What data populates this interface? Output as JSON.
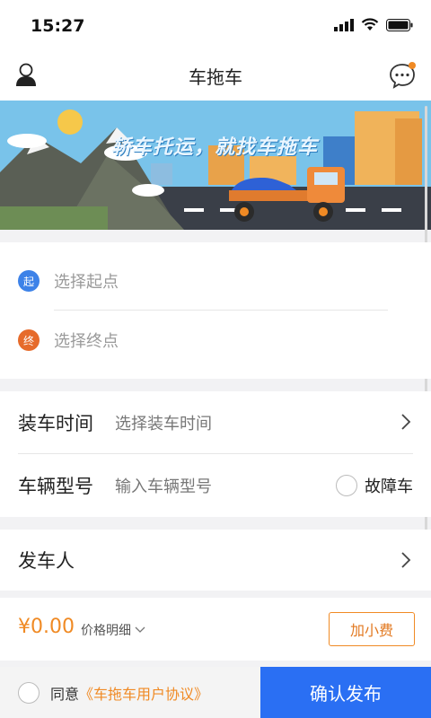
{
  "status": {
    "time": "15:27"
  },
  "nav": {
    "title": "车拖车",
    "has_notification": true
  },
  "banner": {
    "slogan": "轿车托运，就找车拖车"
  },
  "route": {
    "start_badge": "起",
    "start_placeholder": "选择起点",
    "end_badge": "终",
    "end_placeholder": "选择终点"
  },
  "form": {
    "load_time_label": "装车时间",
    "load_time_placeholder": "选择装车时间",
    "model_label": "车辆型号",
    "model_placeholder": "输入车辆型号",
    "fault_label": "故障车"
  },
  "sender": {
    "label": "发车人"
  },
  "price": {
    "amount": "¥0.00",
    "detail_label": "价格明细",
    "tip_button": "加小费"
  },
  "footer": {
    "agree_text": "同意",
    "agreement_link": "《车拖车用户协议》",
    "submit_label": "确认发布"
  },
  "colors": {
    "accent_orange": "#f08a24",
    "primary_blue": "#2a6ff3",
    "start_badge": "#3d82e8",
    "end_badge": "#e66b2b"
  }
}
